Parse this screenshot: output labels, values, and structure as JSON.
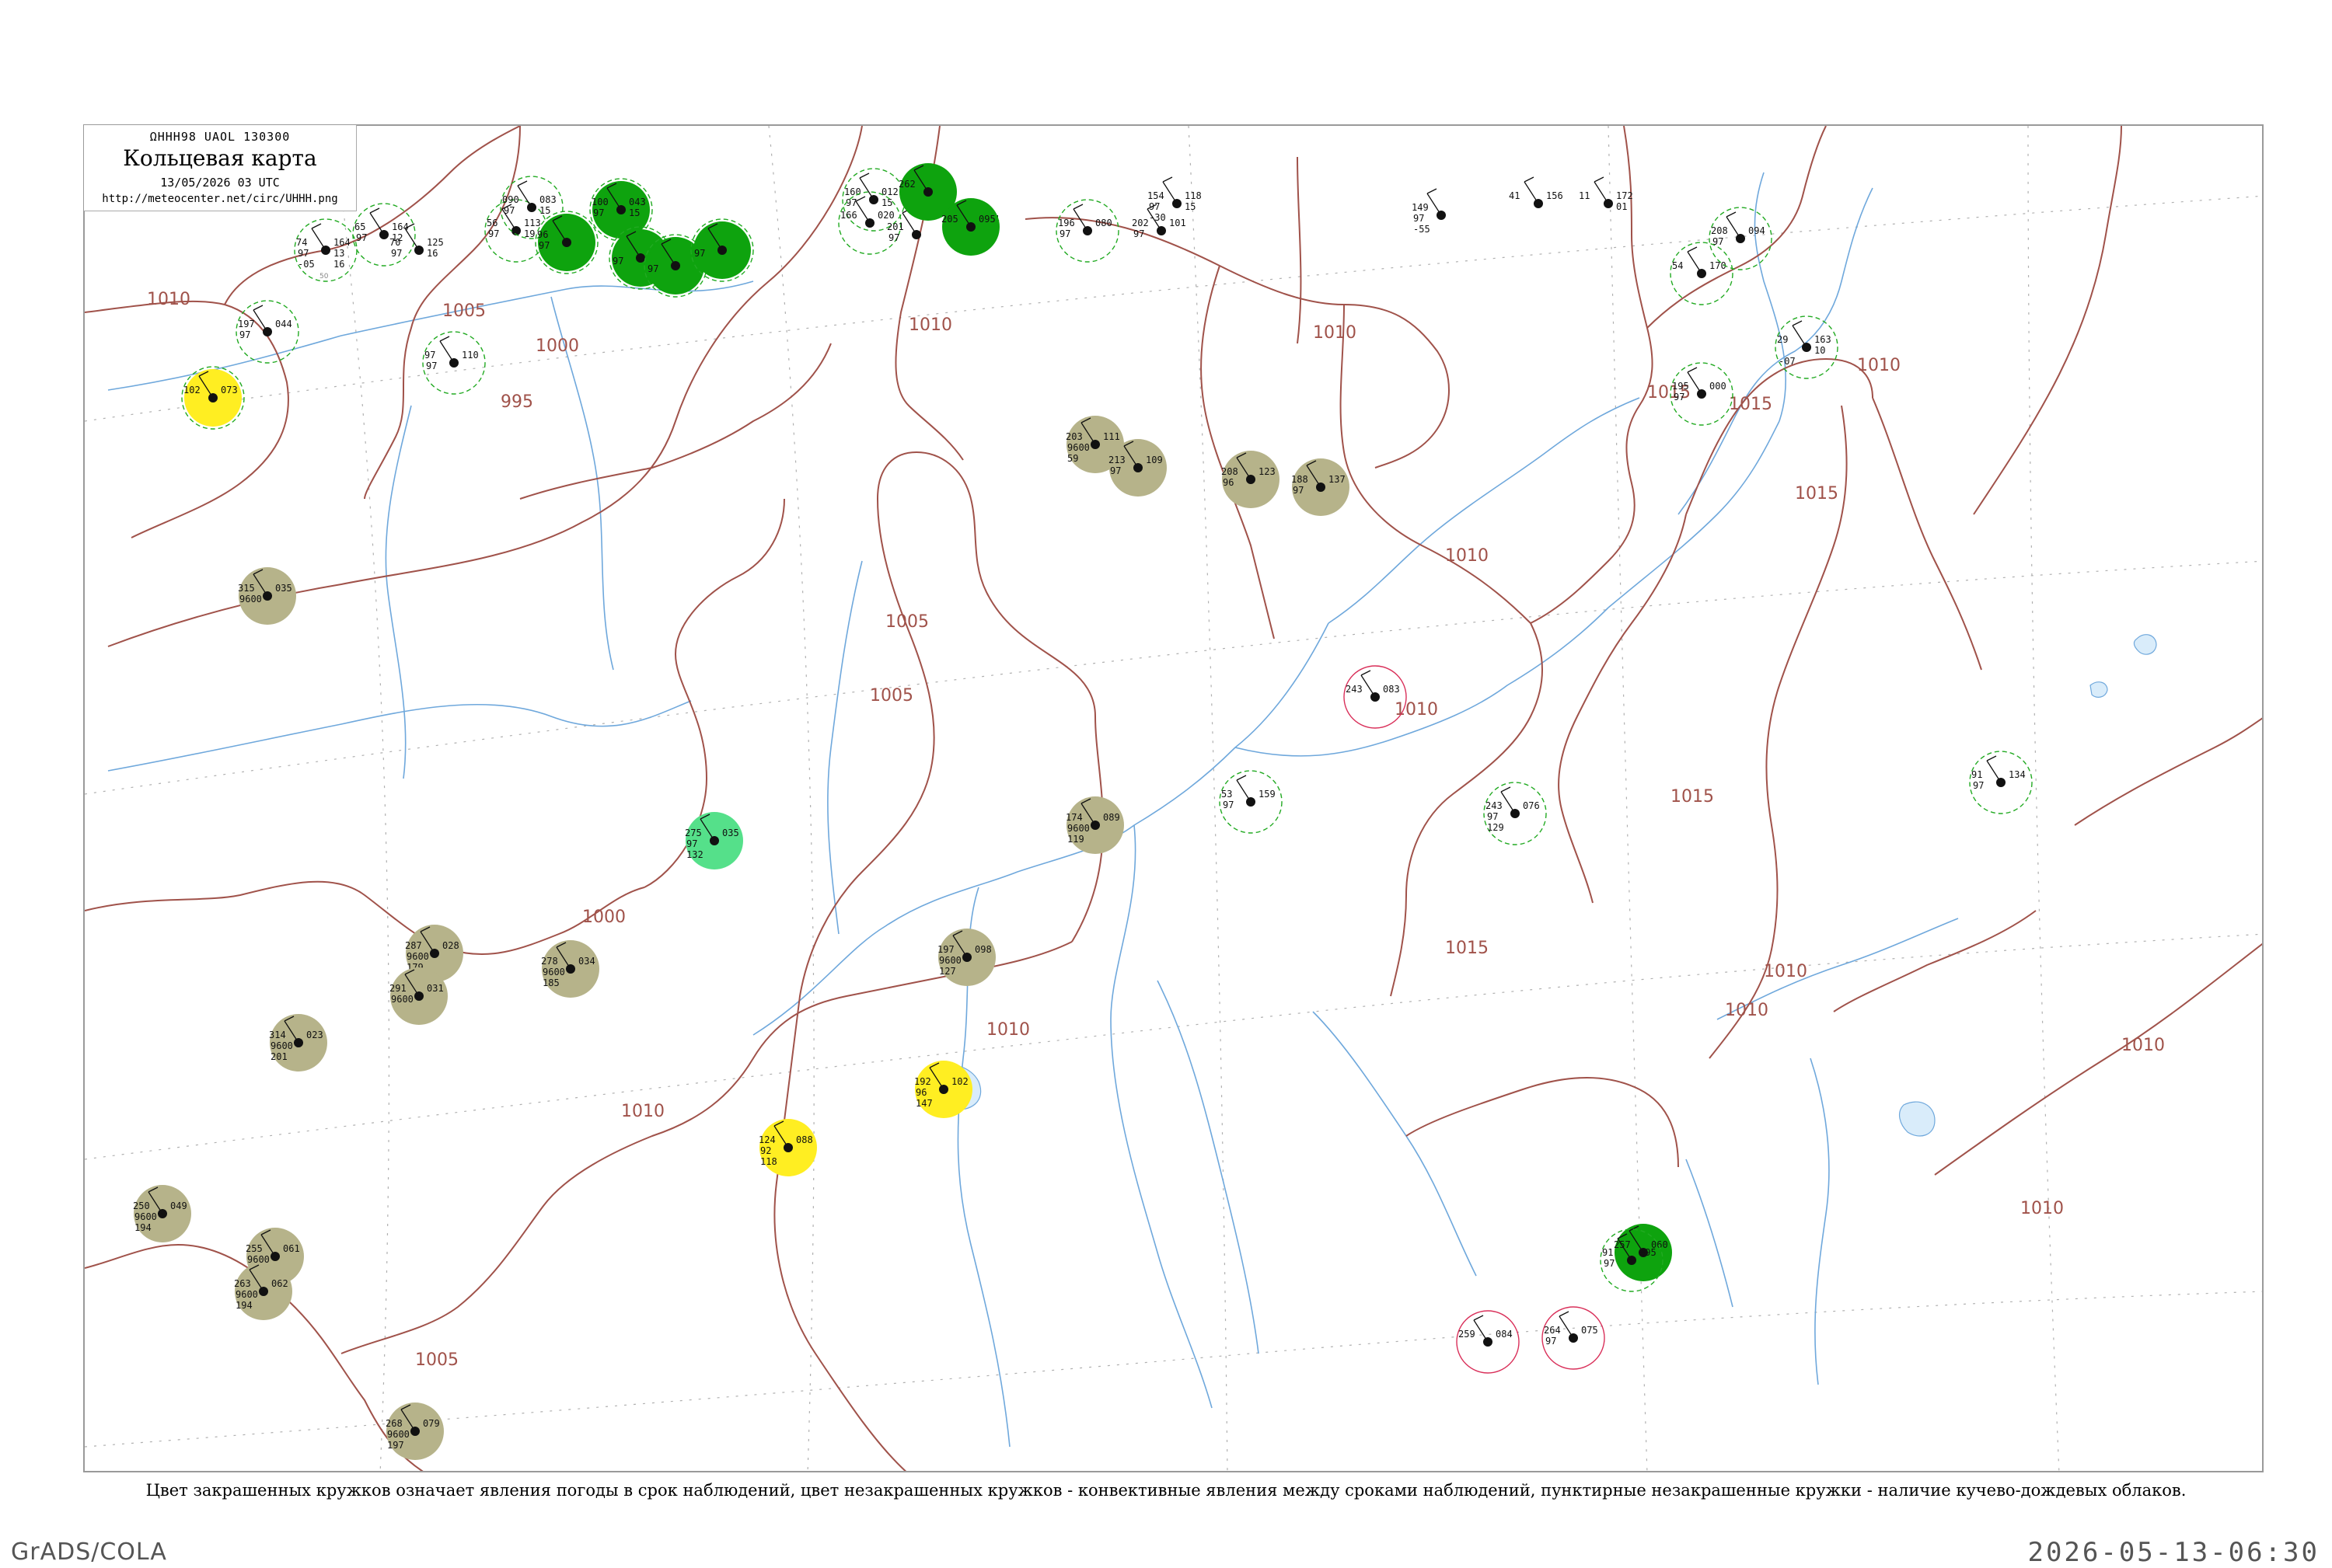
{
  "header": {
    "code": "ΩHHH98  UAOL  130300",
    "title": "Кольцевая карта",
    "date": "13/05/2026 03 UTC",
    "url": "http://meteocenter.net/circ/UHHH.png"
  },
  "caption": "Цвет закрашенных кружков означает явления погоды в срок наблюдений, цвет незакрашенных кружков - конвективные явления между сроками наблюдений, пунктирные незакрашенные кружки - наличие кучево-дождевых облаков.",
  "footer": {
    "left": "GrADS/COLA",
    "right": "2026-05-13-06:30"
  },
  "colors": {
    "isobar": "#a0524a",
    "river": "#6fa8dc",
    "dashed_line": "#9a9a9a",
    "rain": "#0ea30e",
    "drizzle": "#55e08a",
    "haze": "#b6b38a",
    "fog": "#ffee22",
    "cb_ring": "#22aa22",
    "convective_ring": "#d9305a"
  },
  "isobars": [
    {
      "value": "1010"
    },
    {
      "value": "1005"
    },
    {
      "value": "1000"
    },
    {
      "value": "995"
    },
    {
      "value": "1000"
    },
    {
      "value": "1005"
    },
    {
      "value": "1005"
    },
    {
      "value": "1010"
    },
    {
      "value": "1005"
    },
    {
      "value": "1010"
    },
    {
      "value": "1010"
    },
    {
      "value": "1010"
    },
    {
      "value": "1010"
    },
    {
      "value": "1015"
    },
    {
      "value": "1015"
    },
    {
      "value": "1015"
    },
    {
      "value": "1010"
    },
    {
      "value": "1015"
    },
    {
      "value": "1010"
    },
    {
      "value": "1010"
    },
    {
      "value": "1010"
    },
    {
      "value": "1010"
    },
    {
      "value": "1010"
    },
    {
      "value": "1015"
    }
  ],
  "stations": [
    {
      "top": "",
      "left": "74",
      "right": "164",
      "mid": "97",
      "rt2": "13",
      "bl": "-05",
      "br": "16",
      "id": "50",
      "fill": "none",
      "ring": "cb"
    },
    {
      "top": "",
      "left": "65",
      "right": "164",
      "mid": "97",
      "rt2": "12",
      "bl": "",
      "br": "",
      "id": "",
      "fill": "none",
      "ring": "cb"
    },
    {
      "top": "",
      "left": "70",
      "right": "125",
      "mid": "97",
      "rt2": "16",
      "bl": "",
      "br": "",
      "id": "",
      "fill": "none",
      "ring": "none"
    },
    {
      "top": "",
      "left": "56",
      "right": "113",
      "mid": "97",
      "rt2": "19",
      "bl": "",
      "br": "",
      "id": "",
      "fill": "none",
      "ring": "cb"
    },
    {
      "top": "",
      "left": "090",
      "right": "083",
      "mid": "97",
      "rt2": "15",
      "bl": "",
      "br": "",
      "id": "",
      "fill": "none",
      "ring": "cb"
    },
    {
      "top": "",
      "left": "100",
      "right": "043",
      "mid": "97",
      "rt2": "15",
      "bl": "",
      "br": "",
      "id": "",
      "fill": "rain",
      "ring": "cb"
    },
    {
      "top": "",
      "left": "96",
      "right": "",
      "mid": "97",
      "rt2": "",
      "bl": "",
      "br": "",
      "id": "",
      "fill": "rain",
      "ring": "cb"
    },
    {
      "top": "",
      "left": "",
      "right": "",
      "mid": "97",
      "rt2": "",
      "bl": "",
      "br": "",
      "id": "",
      "fill": "rain",
      "ring": "cb"
    },
    {
      "top": "",
      "left": "",
      "right": "",
      "mid": "97",
      "rt2": "",
      "bl": "",
      "br": "",
      "id": "",
      "fill": "rain",
      "ring": "cb"
    },
    {
      "top": "",
      "left": "",
      "right": "",
      "mid": "97",
      "rt2": "",
      "bl": "",
      "br": "",
      "id": "",
      "fill": "rain",
      "ring": "cb"
    },
    {
      "top": "",
      "left": "160",
      "right": "012",
      "mid": "97",
      "rt2": "15",
      "bl": "",
      "br": "",
      "id": "",
      "fill": "none",
      "ring": "cb"
    },
    {
      "top": "",
      "left": "166",
      "right": "020",
      "mid": "",
      "rt2": "",
      "bl": "",
      "br": "",
      "id": "",
      "fill": "none",
      "ring": "cb"
    },
    {
      "top": "",
      "left": "201",
      "right": "",
      "mid": "97",
      "rt2": "",
      "bl": "",
      "br": "",
      "id": "",
      "fill": "none",
      "ring": "none"
    },
    {
      "top": "",
      "left": "215",
      "right": "054",
      "mid": "97",
      "rt2": "",
      "bl": "32",
      "br": "",
      "id": "",
      "fill": "none",
      "ring": "none"
    },
    {
      "top": "",
      "left": "196",
      "right": "080",
      "mid": "97",
      "rt2": "",
      "bl": "",
      "br": "",
      "id": "",
      "fill": "none",
      "ring": "cb"
    },
    {
      "top": "",
      "left": "202",
      "right": "101",
      "mid": "97",
      "rt2": "",
      "bl": "",
      "br": "",
      "id": "",
      "fill": "none",
      "ring": "none"
    },
    {
      "top": "",
      "left": "154",
      "right": "118",
      "mid": "97",
      "rt2": "15",
      "bl": "-30",
      "br": "",
      "id": "",
      "fill": "none",
      "ring": "none"
    },
    {
      "top": "",
      "left": "149",
      "right": "",
      "mid": "97",
      "rt2": "",
      "bl": "-55",
      "br": "",
      "id": "",
      "fill": "none",
      "ring": "none"
    },
    {
      "top": "",
      "left": "41",
      "right": "156",
      "mid": "",
      "rt2": "",
      "bl": "",
      "br": "",
      "id": "",
      "fill": "none",
      "ring": "none"
    },
    {
      "top": "",
      "left": "11",
      "right": "172",
      "mid": "",
      "rt2": "01",
      "bl": "",
      "br": "",
      "id": "",
      "fill": "none",
      "ring": "none"
    },
    {
      "top": "",
      "left": "54",
      "right": "170",
      "mid": "",
      "rt2": "",
      "bl": "",
      "br": "",
      "id": "",
      "fill": "none",
      "ring": "cb"
    },
    {
      "top": "",
      "left": "29",
      "right": "163",
      "mid": "",
      "rt2": "10",
      "bl": "-07",
      "br": "",
      "id": "",
      "fill": "none",
      "ring": "cb"
    },
    {
      "top": "",
      "left": "102",
      "right": "073",
      "mid": "",
      "rt2": "",
      "bl": "",
      "br": "",
      "id": "",
      "fill": "fog",
      "ring": "cb"
    },
    {
      "top": "",
      "left": "315",
      "right": "035",
      "mid": "9600",
      "rt2": "",
      "bl": "",
      "br": "",
      "id": "",
      "fill": "haze",
      "ring": "none"
    },
    {
      "top": "",
      "left": "275",
      "right": "035",
      "mid": "97",
      "rt2": "",
      "bl": "132",
      "br": "",
      "id": "",
      "fill": "drizzle",
      "ring": "none"
    },
    {
      "top": "",
      "left": "124",
      "right": "088",
      "mid": "92",
      "rt2": "",
      "bl": "118",
      "br": "",
      "id": "",
      "fill": "fog",
      "ring": "none"
    },
    {
      "top": "",
      "left": "192",
      "right": "102",
      "mid": "96",
      "rt2": "",
      "bl": "147",
      "br": "",
      "id": "",
      "fill": "fog",
      "ring": "none"
    },
    {
      "top": "",
      "left": "203",
      "right": "111",
      "mid": "9600",
      "rt2": "",
      "bl": "59",
      "br": "",
      "id": "",
      "fill": "haze",
      "ring": "none"
    },
    {
      "top": "",
      "left": "213",
      "right": "109",
      "mid": "97",
      "rt2": "",
      "bl": "",
      "br": "",
      "id": "",
      "fill": "haze",
      "ring": "none"
    },
    {
      "top": "",
      "left": "208",
      "right": "123",
      "mid": "96",
      "rt2": "",
      "bl": "",
      "br": "",
      "id": "",
      "fill": "haze",
      "ring": "none"
    },
    {
      "top": "",
      "left": "188",
      "right": "137",
      "mid": "97",
      "rt2": "",
      "bl": "",
      "br": "",
      "id": "",
      "fill": "haze",
      "ring": "none"
    },
    {
      "top": "",
      "left": "174",
      "right": "089",
      "mid": "9600",
      "rt2": "",
      "bl": "119",
      "br": "",
      "id": "",
      "fill": "haze",
      "ring": "none"
    },
    {
      "top": "",
      "left": "197",
      "right": "098",
      "mid": "9600",
      "rt2": "",
      "bl": "127",
      "br": "",
      "id": "",
      "fill": "haze",
      "ring": "none"
    },
    {
      "top": "",
      "left": "287",
      "right": "028",
      "mid": "9600",
      "rt2": "",
      "bl": "179",
      "br": "",
      "id": "",
      "fill": "haze",
      "ring": "none"
    },
    {
      "top": "",
      "left": "291",
      "right": "031",
      "mid": "9600",
      "rt2": "",
      "bl": "",
      "br": "",
      "id": "",
      "fill": "haze",
      "ring": "none"
    },
    {
      "top": "",
      "left": "278",
      "right": "034",
      "mid": "9600",
      "rt2": "",
      "bl": "185",
      "br": "",
      "id": "",
      "fill": "haze",
      "ring": "none"
    },
    {
      "top": "",
      "left": "314",
      "right": "023",
      "mid": "9600",
      "rt2": "",
      "bl": "201",
      "br": "",
      "id": "",
      "fill": "haze",
      "ring": "none"
    },
    {
      "top": "",
      "left": "250",
      "right": "049",
      "mid": "9600",
      "rt2": "",
      "bl": "194",
      "br": "",
      "id": "",
      "fill": "haze",
      "ring": "none"
    },
    {
      "top": "",
      "left": "255",
      "right": "061",
      "mid": "9600",
      "rt2": "",
      "bl": "199",
      "br": "",
      "id": "",
      "fill": "haze",
      "ring": "none"
    },
    {
      "top": "",
      "left": "263",
      "right": "062",
      "mid": "9600",
      "rt2": "",
      "bl": "194",
      "br": "",
      "id": "",
      "fill": "haze",
      "ring": "none"
    },
    {
      "top": "",
      "left": "268",
      "right": "079",
      "mid": "9600",
      "rt2": "",
      "bl": "197",
      "br": "",
      "id": "",
      "fill": "haze",
      "ring": "none"
    },
    {
      "top": "",
      "left": "257",
      "right": "060",
      "mid": "",
      "rt2": "",
      "bl": "",
      "br": "",
      "id": "",
      "fill": "rain",
      "ring": "none"
    },
    {
      "top": "",
      "left": "262",
      "right": "",
      "mid": "",
      "rt2": "",
      "bl": "",
      "br": "",
      "id": "",
      "fill": "rain",
      "ring": "none"
    },
    {
      "top": "",
      "left": "205",
      "right": "095",
      "mid": "",
      "rt2": "",
      "bl": "",
      "br": "",
      "id": "",
      "fill": "rain",
      "ring": "none"
    },
    {
      "top": "",
      "left": "208",
      "right": "094",
      "mid": "97",
      "rt2": "",
      "bl": "",
      "br": "",
      "id": "",
      "fill": "none",
      "ring": "cb"
    },
    {
      "top": "",
      "left": "243",
      "right": "083",
      "mid": "",
      "rt2": "",
      "bl": "",
      "br": "",
      "id": "",
      "fill": "none",
      "ring": "convective"
    },
    {
      "top": "",
      "left": "259",
      "right": "084",
      "mid": "",
      "rt2": "",
      "bl": "",
      "br": "",
      "id": "",
      "fill": "none",
      "ring": "convective"
    },
    {
      "top": "",
      "left": "264",
      "right": "075",
      "mid": "97",
      "rt2": "",
      "bl": "",
      "br": "",
      "id": "",
      "fill": "none",
      "ring": "convective"
    },
    {
      "top": "",
      "left": "91",
      "right": "095",
      "mid": "97",
      "rt2": "",
      "bl": "",
      "br": "",
      "id": "",
      "fill": "none",
      "ring": "cb"
    },
    {
      "top": "",
      "left": "91",
      "right": "134",
      "mid": "97",
      "rt2": "",
      "bl": "",
      "br": "",
      "id": "",
      "fill": "none",
      "ring": "cb"
    },
    {
      "top": "",
      "left": "243",
      "right": "076",
      "mid": "97",
      "rt2": "",
      "bl": "129",
      "br": "",
      "id": "",
      "fill": "none",
      "ring": "cb"
    },
    {
      "top": "",
      "left": "53",
      "right": "159",
      "mid": "97",
      "rt2": "",
      "bl": "",
      "br": "",
      "id": "",
      "fill": "none",
      "ring": "cb"
    },
    {
      "top": "",
      "left": "195",
      "right": "000",
      "mid": "97",
      "rt2": "",
      "bl": "",
      "br": "",
      "id": "",
      "fill": "none",
      "ring": "cb"
    },
    {
      "top": "",
      "left": "97",
      "right": "110",
      "mid": "97",
      "rt2": "",
      "bl": "",
      "br": "",
      "id": "",
      "fill": "none",
      "ring": "cb"
    },
    {
      "top": "",
      "left": "197",
      "right": "044",
      "mid": "97",
      "rt2": "",
      "bl": "",
      "br": "",
      "id": "",
      "fill": "none",
      "ring": "cb"
    }
  ]
}
